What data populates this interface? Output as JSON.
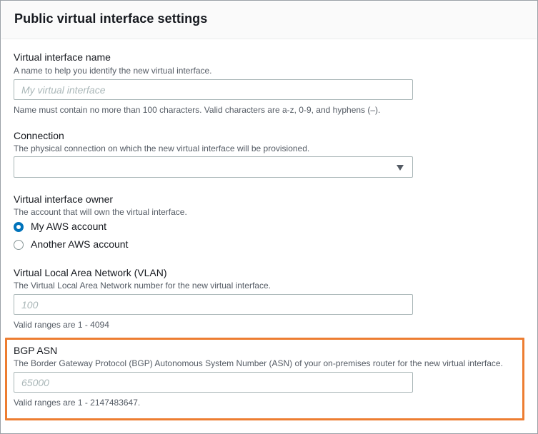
{
  "panel": {
    "title": "Public virtual interface settings"
  },
  "fields": {
    "vif_name": {
      "label": "Virtual interface name",
      "description": "A name to help you identify the new virtual interface.",
      "placeholder": "My virtual interface",
      "value": "",
      "hint": "Name must contain no more than 100 characters. Valid characters are a-z, 0-9, and hyphens (–)."
    },
    "connection": {
      "label": "Connection",
      "description": "The physical connection on which the new virtual interface will be provisioned.",
      "selected": "",
      "caret_icon": "caret-down-icon"
    },
    "owner": {
      "label": "Virtual interface owner",
      "description": "The account that will own the virtual interface.",
      "options": [
        {
          "label": "My AWS account",
          "checked": true
        },
        {
          "label": "Another AWS account",
          "checked": false
        }
      ]
    },
    "vlan": {
      "label": "Virtual Local Area Network (VLAN)",
      "description": "The Virtual Local Area Network number for the new virtual interface.",
      "placeholder": "100",
      "value": "",
      "hint": "Valid ranges are 1 - 4094"
    },
    "bgp_asn": {
      "label": "BGP ASN",
      "description": "The Border Gateway Protocol (BGP) Autonomous System Number (ASN) of your on-premises router for the new virtual interface.",
      "placeholder": "65000",
      "value": "",
      "hint": "Valid ranges are 1 - 2147483647."
    }
  },
  "colors": {
    "accent": "#0073bb",
    "highlight": "#ed7d31",
    "border": "#aab7b8",
    "secondary_text": "#545b64"
  }
}
